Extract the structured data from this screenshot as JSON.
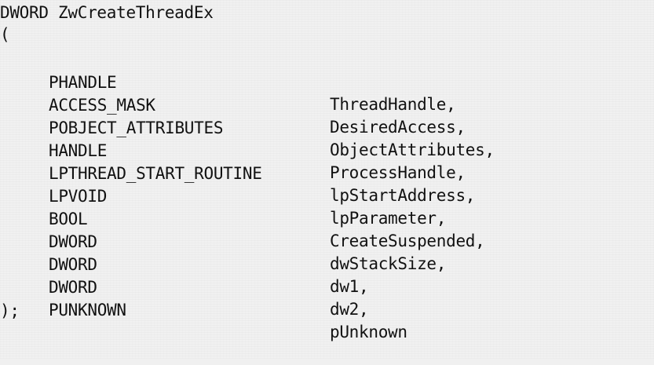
{
  "code": {
    "signature": "DWORD ZwCreateThreadEx",
    "open_paren": "(",
    "params": [
      {
        "type": "PHANDLE",
        "name": "ThreadHandle,"
      },
      {
        "type": "ACCESS_MASK",
        "name": "DesiredAccess,"
      },
      {
        "type": "POBJECT_ATTRIBUTES",
        "name": "ObjectAttributes,"
      },
      {
        "type": "HANDLE",
        "name": "ProcessHandle,"
      },
      {
        "type": "LPTHREAD_START_ROUTINE",
        "name": "lpStartAddress,"
      },
      {
        "type": "LPVOID",
        "name": "lpParameter,"
      },
      {
        "type": "BOOL",
        "name": "CreateSuspended,"
      },
      {
        "type": "DWORD",
        "name": "dwStackSize,"
      },
      {
        "type": "DWORD",
        "name": "dw1,"
      },
      {
        "type": "DWORD",
        "name": "dw2,"
      },
      {
        "type": "PUNKNOWN",
        "name": "pUnknown"
      }
    ],
    "close": ");"
  }
}
